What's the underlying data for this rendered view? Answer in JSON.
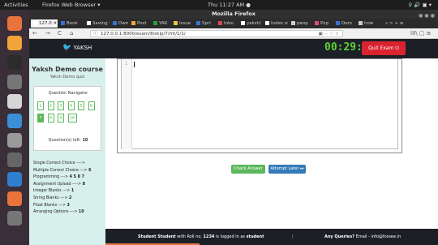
{
  "system": {
    "activities": "Activities",
    "app_menu": "Firefox Web Browser ▾",
    "clock": "Thu 11:27 AM ●",
    "tray": "⚲ 🔊 ▣ ▾"
  },
  "window": {
    "title": "Mozilla Firefox"
  },
  "tabs": [
    {
      "label": "127.0 ✕",
      "color": "#ffffff",
      "active": true
    },
    {
      "label": "Book",
      "color": "#3b6fd8"
    },
    {
      "label": "Saving t",
      "color": "#ffffff"
    },
    {
      "label": "Own",
      "color": "#3b6fd8"
    },
    {
      "label": "Post",
      "color": "#f0a83a"
    },
    {
      "label": "YAK",
      "color": "#2a9d3a"
    },
    {
      "label": "Issue",
      "color": "#e8c84a"
    },
    {
      "label": "Spri",
      "color": "#3b6fd8"
    },
    {
      "label": "Inbo",
      "color": "#d84a4a"
    },
    {
      "label": "yaksh/",
      "color": "#ffffff"
    },
    {
      "label": "Index of",
      "color": "#ffffff"
    },
    {
      "label": "peop",
      "color": "#cccccc"
    },
    {
      "label": "Pop",
      "color": "#e04a7a"
    },
    {
      "label": "Dem",
      "color": "#3b6fd8"
    },
    {
      "label": "how",
      "color": "#cccccc"
    },
    {
      "label": "« > + ≡",
      "color": "#2b2b2b"
    }
  ],
  "nav": {
    "back": "←",
    "forward": "→",
    "reload": "C",
    "home": "⌂",
    "url": "127.0.0.1:8000/exam/8/skip/7/mt/1/1/",
    "url_icon": "ⓘ",
    "page_actions": "▣ ··· ♡ ☆",
    "library": "III\\ ▢ ≡"
  },
  "header": {
    "logo_mark": "🐦",
    "logo_text": "YAKSH",
    "timer": "00:29:22",
    "quit_label": "Quit Exam ⏻"
  },
  "sidebar": {
    "course_title": "Yaksh Demo course",
    "quiz_name": "Yaksh Demo quiz",
    "navigator_title": "Question Navigator",
    "question_numbers": [
      "1",
      "2",
      "3",
      "4",
      "5",
      "6",
      "7",
      "8",
      "9",
      "10"
    ],
    "current_question": "7",
    "questions_left_label": "Question(s) left: ",
    "questions_left": "10",
    "question_types": [
      {
        "label": "Single Correct Choice ---->",
        "value": ""
      },
      {
        "label": "Multiple Correct Choice ---> ",
        "value": "6"
      },
      {
        "label": "Programming ---> ",
        "value": "4 5 8 7"
      },
      {
        "label": "Assignment Upload ----> ",
        "value": "8"
      },
      {
        "label": "Integer Blanks ---> ",
        "value": "1"
      },
      {
        "label": "String Blanks ---> ",
        "value": "2"
      },
      {
        "label": "Float Blanks ---> ",
        "value": "3"
      },
      {
        "label": "Arranging Options ---> ",
        "value": "10"
      }
    ]
  },
  "editor": {
    "line_number": "1"
  },
  "actions": {
    "check_label": "Check Answer",
    "later_label": "Attempt Later ⏭"
  },
  "footer": {
    "student_prefix": "Student Student",
    "roll_text": " with Roll no. ",
    "roll_no": "1234",
    "logged_text": " is logged in as ",
    "role": "student",
    "separator": "|",
    "queries_label": "Any Queries?",
    "email_text": " Email - info@fossee.in"
  },
  "dock_icons": [
    {
      "name": "firefox-icon",
      "color": "#e8743b"
    },
    {
      "name": "sublime-icon",
      "color": "#f2a33a"
    },
    {
      "name": "terminal-icon",
      "color": "#2c2c2c"
    },
    {
      "name": "disk-icon",
      "color": "#777777"
    },
    {
      "name": "text-editor-icon",
      "color": "#d6d6d6"
    },
    {
      "name": "spheres-icon",
      "color": "#3a8fd8"
    },
    {
      "name": "files-icon",
      "color": "#9a9a9a"
    },
    {
      "name": "webcam-icon",
      "color": "#666666"
    },
    {
      "name": "writer-icon",
      "color": "#2f7fd0"
    },
    {
      "name": "software-center-icon",
      "color": "#e8743b"
    },
    {
      "name": "drive-icon",
      "color": "#777777"
    },
    {
      "name": "app-grid-icon",
      "color": "#3a2e38"
    }
  ]
}
